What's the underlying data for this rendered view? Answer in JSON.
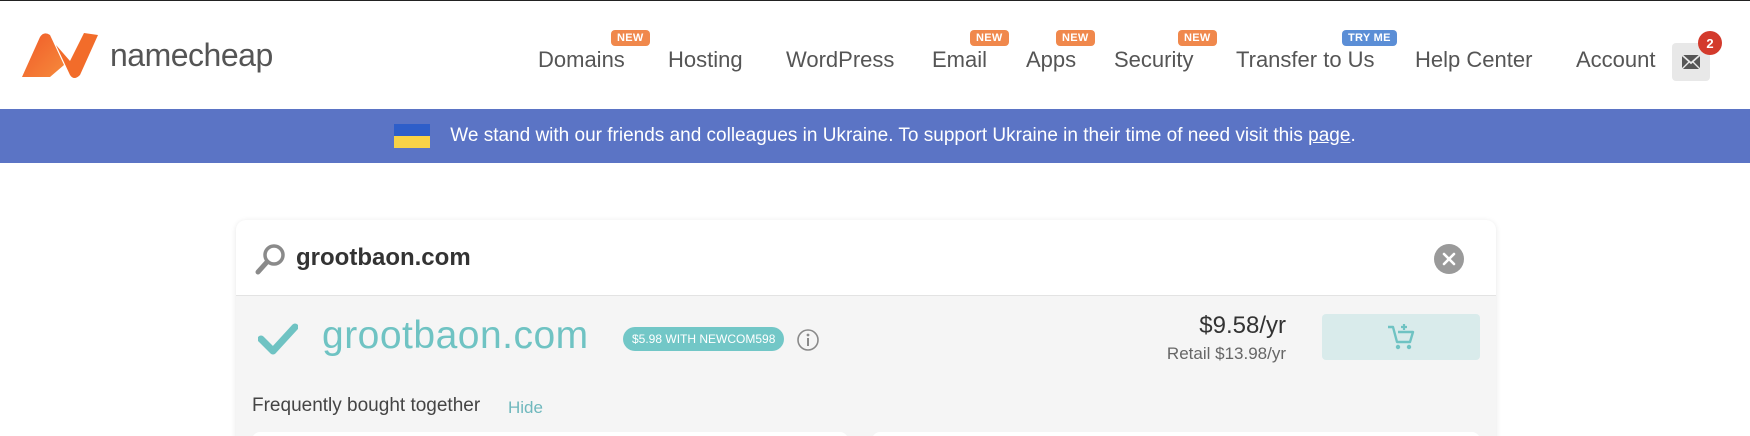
{
  "brand": {
    "name": "namecheap"
  },
  "nav": [
    {
      "label": "Domains",
      "badge": "NEW",
      "badge_type": "new"
    },
    {
      "label": "Hosting",
      "badge": "",
      "badge_type": ""
    },
    {
      "label": "WordPress",
      "badge": "",
      "badge_type": ""
    },
    {
      "label": "Email",
      "badge": "NEW",
      "badge_type": "new"
    },
    {
      "label": "Apps",
      "badge": "NEW",
      "badge_type": "new"
    },
    {
      "label": "Security",
      "badge": "NEW",
      "badge_type": "new"
    },
    {
      "label": "Transfer to Us",
      "badge": "TRY ME",
      "badge_type": "try"
    },
    {
      "label": "Help Center",
      "badge": "",
      "badge_type": ""
    },
    {
      "label": "Account",
      "badge": "",
      "badge_type": ""
    }
  ],
  "mail": {
    "count": "2"
  },
  "banner": {
    "text": "We stand with our friends and colleagues in Ukraine. To support Ukraine in their time of need visit this ",
    "link": "page",
    "suffix": "."
  },
  "search": {
    "value": "grootbaon.com"
  },
  "result": {
    "domain": "grootbaon.com",
    "promo": "$5.98 WITH NEWCOM598",
    "price": "$9.58/yr",
    "retail": "Retail $13.98/yr"
  },
  "fbt": {
    "label": "Frequently bought together",
    "hide": "Hide"
  },
  "colors": {
    "brand_orange": "#f26c2a",
    "banner_blue": "#5b74c5",
    "teal": "#6fc3c3",
    "badge_new": "#f0884c",
    "badge_try": "#5b8ed6",
    "mail_badge": "#d33a2c"
  }
}
